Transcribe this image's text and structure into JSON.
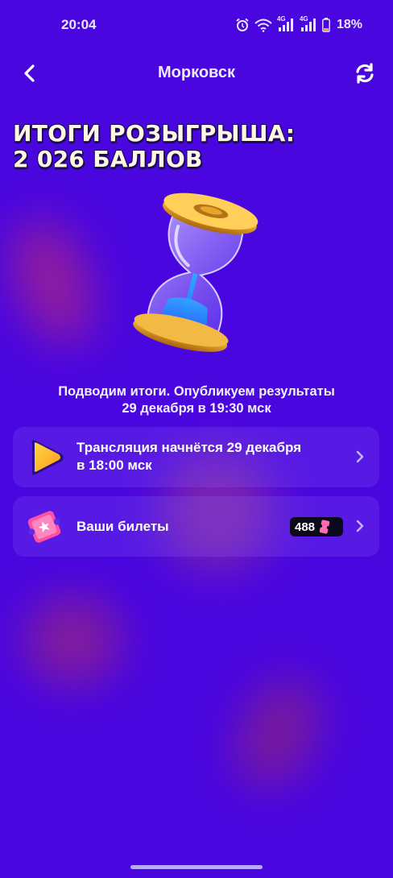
{
  "status_bar": {
    "time": "20:04",
    "battery": "18%",
    "icons": [
      "alarm-icon",
      "wifi-icon",
      "signal-4g-icon",
      "signal-4g-icon",
      "battery-icon"
    ],
    "network_label_1": "4G",
    "network_label_2": "4G"
  },
  "header": {
    "title": "Морковск",
    "back_icon": "chevron-left-icon",
    "refresh_icon": "refresh-icon"
  },
  "headline": {
    "line1": "ИТОГИ РОЗЫГРЫША:",
    "line2": "2 026 БАЛЛОВ"
  },
  "illustration": "hourglass-icon",
  "summary": {
    "line1": "Подводим итоги. Опубликуем результаты",
    "line2": "29 декабря в 19:30 мск"
  },
  "cards": {
    "stream": {
      "line1": "Трансляция начнётся 29 декабря",
      "line2": "в 18:00 мск",
      "icon": "play-icon"
    },
    "tickets": {
      "label": "Ваши билеты",
      "count": "488",
      "icon": "ticket-icon"
    }
  },
  "colors": {
    "background": "#4a06df",
    "card": "#6b3cf0",
    "accent_gold": "#e7a62b",
    "ticket_pink": "#ff4fa0"
  }
}
